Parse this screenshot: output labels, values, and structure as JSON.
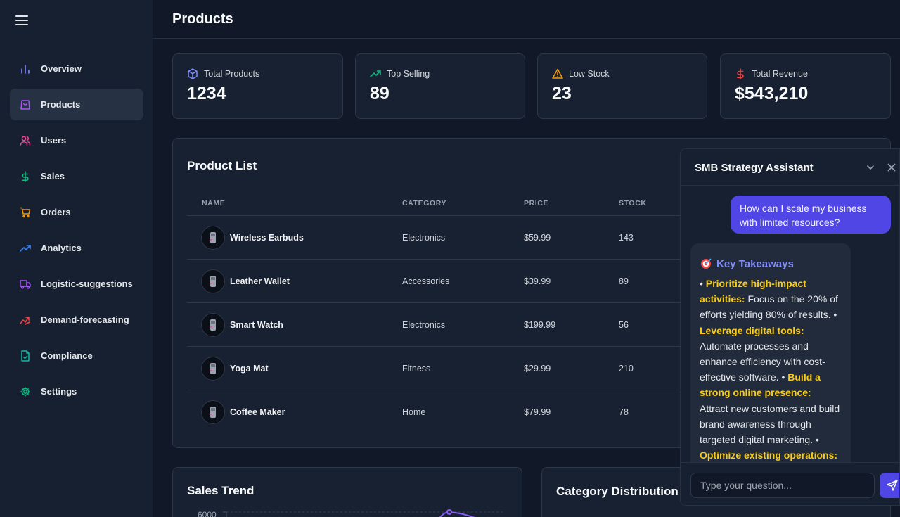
{
  "header": {
    "title": "Products"
  },
  "sidebar": {
    "items": [
      {
        "label": "Overview",
        "icon": "bar-chart-icon",
        "color": "#818cf8"
      },
      {
        "label": "Products",
        "icon": "shopping-bag-icon",
        "color": "#a855f7"
      },
      {
        "label": "Users",
        "icon": "users-icon",
        "color": "#ec4899"
      },
      {
        "label": "Sales",
        "icon": "dollar-sign-icon",
        "color": "#10b981"
      },
      {
        "label": "Orders",
        "icon": "shopping-cart-icon",
        "color": "#f59e0b"
      },
      {
        "label": "Analytics",
        "icon": "trending-up-icon",
        "color": "#3b82f6"
      },
      {
        "label": "Logistic-suggestions",
        "icon": "truck-icon",
        "color": "#a855f7"
      },
      {
        "label": "Demand-forecasting",
        "icon": "trend-arrow-icon",
        "color": "#ef4444"
      },
      {
        "label": "Compliance",
        "icon": "file-check-icon",
        "color": "#14b8a6"
      },
      {
        "label": "Settings",
        "icon": "gear-icon",
        "color": "#10b981"
      }
    ],
    "active": "Products"
  },
  "stats": [
    {
      "label": "Total Products",
      "value": "1234",
      "icon": "package-icon",
      "color": "#818cf8"
    },
    {
      "label": "Top Selling",
      "value": "89",
      "icon": "trending-up-icon",
      "color": "#10b981"
    },
    {
      "label": "Low Stock",
      "value": "23",
      "icon": "warning-icon",
      "color": "#f59e0b"
    },
    {
      "label": "Total Revenue",
      "value": "$543,210",
      "icon": "dollar-sign-icon",
      "color": "#ef4444"
    }
  ],
  "product_list": {
    "title": "Product List",
    "columns": [
      "NAME",
      "CATEGORY",
      "PRICE",
      "STOCK"
    ],
    "rows": [
      {
        "name": "Wireless Earbuds",
        "category": "Electronics",
        "price": "$59.99",
        "stock": "143"
      },
      {
        "name": "Leather Wallet",
        "category": "Accessories",
        "price": "$39.99",
        "stock": "89"
      },
      {
        "name": "Smart Watch",
        "category": "Electronics",
        "price": "$199.99",
        "stock": "56"
      },
      {
        "name": "Yoga Mat",
        "category": "Fitness",
        "price": "$29.99",
        "stock": "210"
      },
      {
        "name": "Coffee Maker",
        "category": "Home",
        "price": "$79.99",
        "stock": "78"
      }
    ]
  },
  "sales_trend": {
    "title": "Sales Trend",
    "y_tick_top": "6000"
  },
  "category_distribution": {
    "title": "Category Distribution"
  },
  "chat": {
    "title": "SMB Strategy Assistant",
    "user_message": "How can I scale my business with limited resources?",
    "bot_heading": "Key Takeaways",
    "bot_heading_icon": "target-icon",
    "bot_points": [
      {
        "bullet": "• ",
        "title": "Prioritize high-impact activities:",
        "text": " Focus on the 20% of efforts yielding 80% of results. "
      },
      {
        "bullet": "• ",
        "title": "Leverage digital tools:",
        "text": " Automate processes and enhance efficiency with cost-effective software. "
      },
      {
        "bullet": "• ",
        "title": "Build a strong online presence:",
        "text": " Attract new customers and build brand awareness through targeted digital marketing. "
      },
      {
        "bullet": "• ",
        "title": "Optimize existing operations:",
        "text": ""
      }
    ],
    "input_placeholder": "Type your question..."
  }
}
